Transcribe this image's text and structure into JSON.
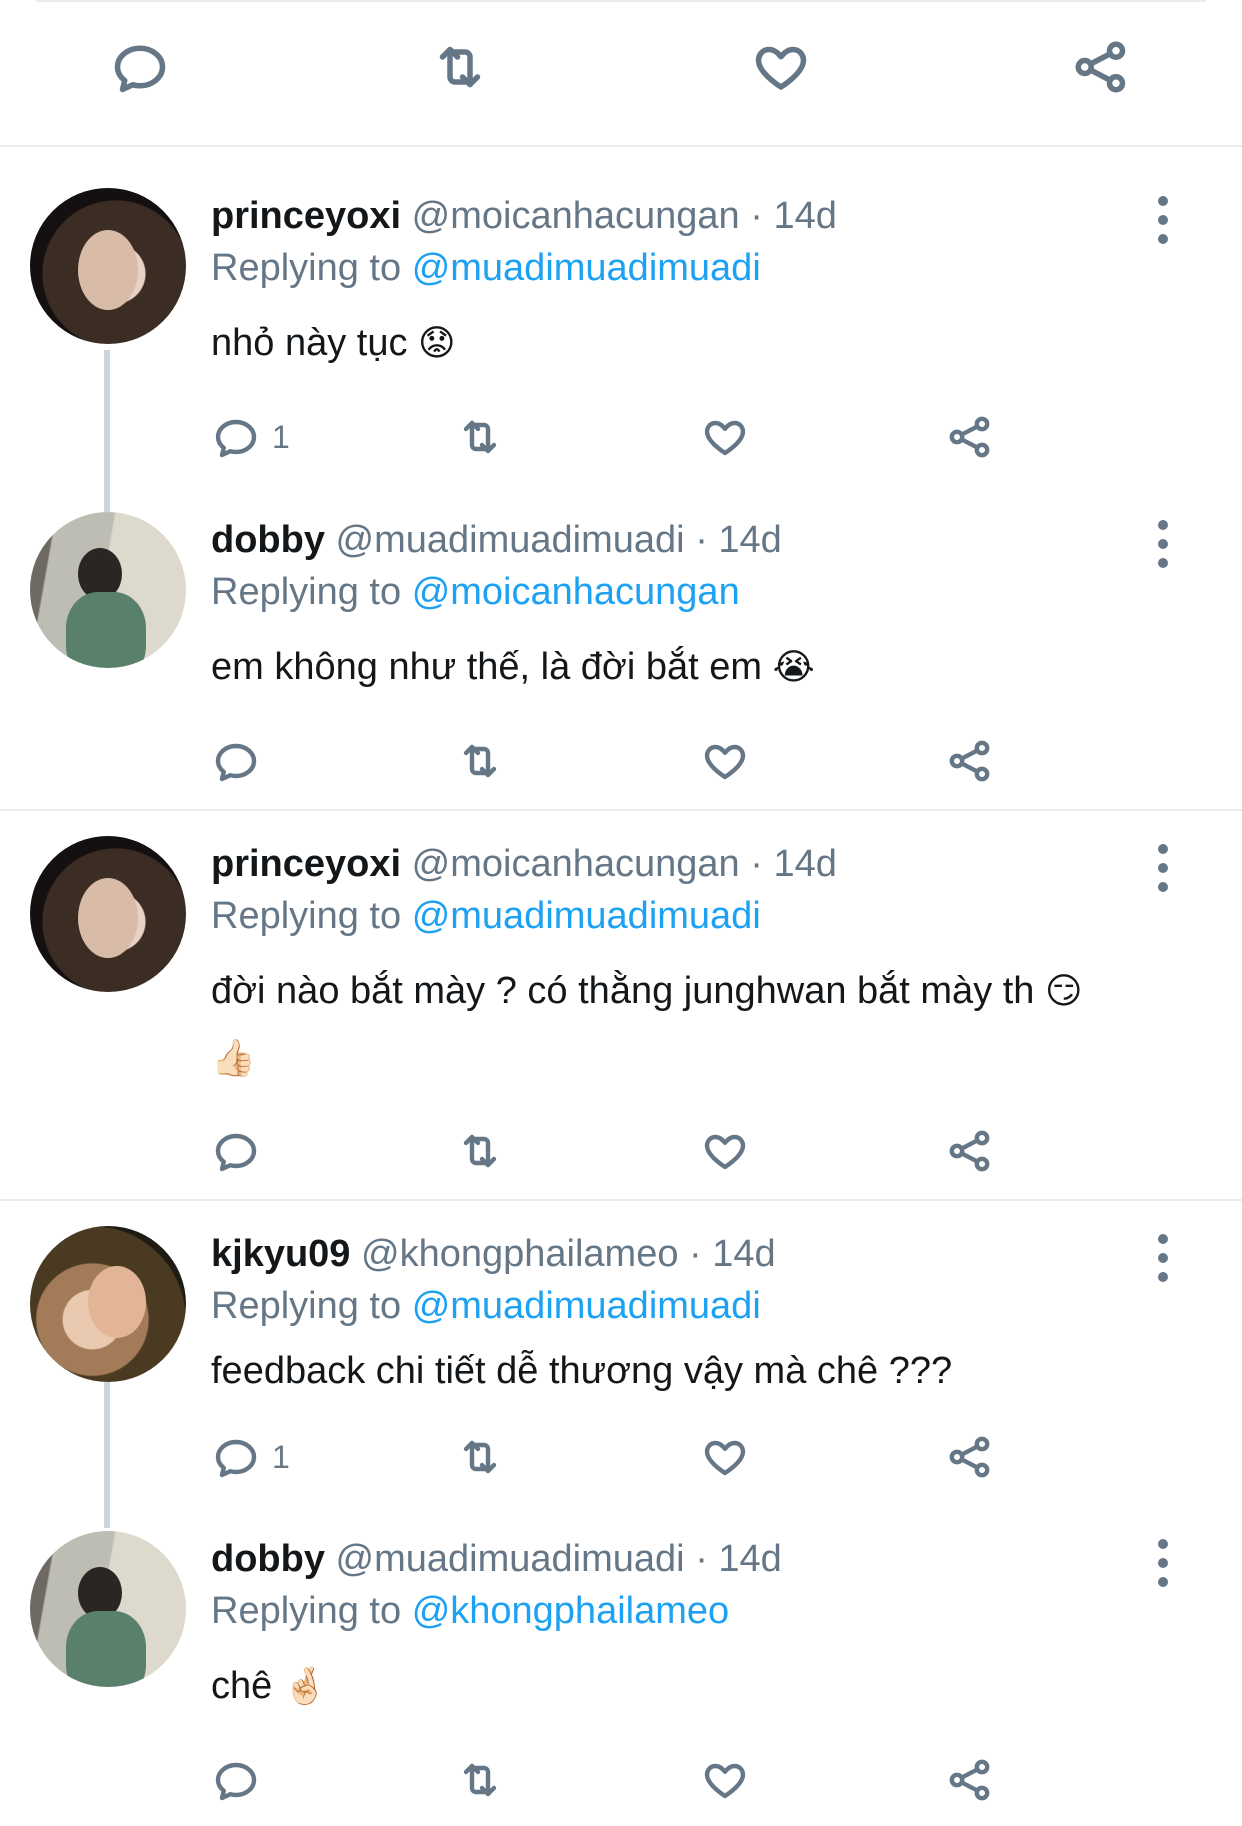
{
  "top_actions": {
    "icons": [
      "reply-icon",
      "retweet-icon",
      "like-icon",
      "share-icon"
    ]
  },
  "tweets": [
    {
      "name": "princeyoxi",
      "handle": "@moicanhacungan",
      "time": "14d",
      "replying_prefix": "Replying to",
      "replying_to": "@muadimuadimuadi",
      "text": "nhỏ này tục",
      "emoji": "😟",
      "reply_count": "1"
    },
    {
      "name": "dobby",
      "handle": "@muadimuadimuadi",
      "time": "14d",
      "replying_prefix": "Replying to",
      "replying_to": "@moicanhacungan",
      "text": "em không như thế, là đời bắt em",
      "emoji": "😭",
      "reply_count": ""
    },
    {
      "name": "princeyoxi",
      "handle": "@moicanhacungan",
      "time": "14d",
      "replying_prefix": "Replying to",
      "replying_to": "@muadimuadimuadi",
      "text": "đời nào bắt mày ? có thằng junghwan bắt mày th",
      "emoji": "😏",
      "emoji_line2": "👍🏻",
      "reply_count": ""
    },
    {
      "name": "kjkyu09",
      "handle": "@khongphailameo",
      "time": "14d",
      "replying_prefix": "Replying to",
      "replying_to": "@muadimuadimuadi",
      "text": "feedback chi tiết dễ thương vậy mà chê ???",
      "emoji": "",
      "reply_count": "1"
    },
    {
      "name": "dobby",
      "handle": "@muadimuadimuadi",
      "time": "14d",
      "replying_prefix": "Replying to",
      "replying_to": "@khongphailameo",
      "text": "chê",
      "emoji": "🤞🏻",
      "reply_count": ""
    }
  ],
  "colors": {
    "text": "#14171a",
    "secondary": "#657786",
    "link": "#1da1f2",
    "divider": "#e6ecf0",
    "thread_line": "#ccd6dd"
  }
}
